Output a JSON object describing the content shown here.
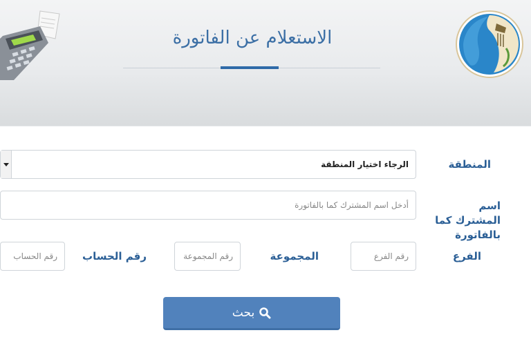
{
  "header": {
    "title": "الاستعلام عن الفاتورة"
  },
  "form": {
    "region": {
      "label": "المنطقة",
      "selected": "الرجاء اختيار المنطقة"
    },
    "subscriber": {
      "label": "اسم المشترك كما بالفاتورة",
      "placeholder": "أدخل اسم المشترك كما بالفاتورة"
    },
    "branch": {
      "label": "الفرع",
      "placeholder": "رقم الفرع"
    },
    "group": {
      "label": "المجموعة",
      "placeholder": "رقم المجموعة"
    },
    "account": {
      "label": "رقم الحساب",
      "placeholder": "رقم الحساب"
    },
    "search_button": "بحث"
  },
  "colors": {
    "accent": "#2f6aa8",
    "label": "#2b5f96",
    "button": "#5182bc",
    "title": "#3b6fa5"
  },
  "icons": {
    "pos": "card-payment-terminal-icon",
    "logo": "water-company-logo-icon",
    "search": "search-icon",
    "dropdown": "chevron-down-icon"
  }
}
